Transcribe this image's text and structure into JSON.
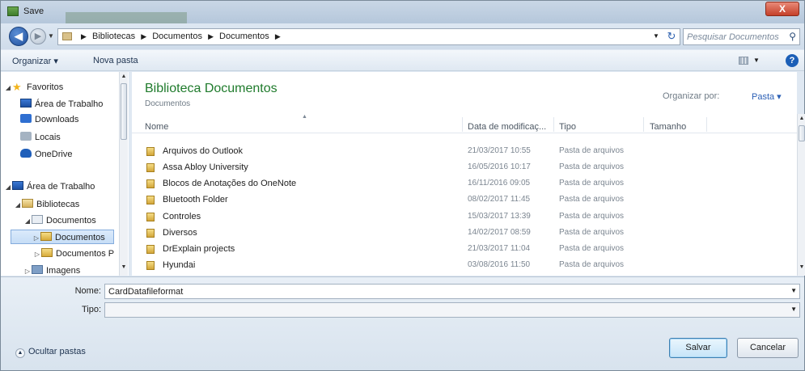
{
  "window": {
    "title": "Save",
    "close_label": "X"
  },
  "address": {
    "crumbs": [
      "Bibliotecas",
      "Documentos",
      "Documentos"
    ],
    "search_placeholder": "Pesquisar Documentos"
  },
  "toolbar": {
    "organize_label": "Organizar ▾",
    "new_folder_label": "Nova pasta",
    "help_label": "?"
  },
  "nav": {
    "items": [
      {
        "label": "Favoritos",
        "icon": "star-icon"
      },
      {
        "label": "Área de Trabalho",
        "icon": "desktop-icon"
      },
      {
        "label": "Downloads",
        "icon": "downloads-icon"
      },
      {
        "label": "Locais",
        "icon": "places-icon"
      },
      {
        "label": "OneDrive",
        "icon": "cloud-icon"
      },
      {
        "label": "Área de Trabalho",
        "icon": "desktop-icon"
      },
      {
        "label": "Bibliotecas",
        "icon": "library-icon"
      },
      {
        "label": "Documentos",
        "icon": "documents-icon"
      },
      {
        "label": "Documentos",
        "icon": "folder-icon"
      },
      {
        "label": "Documentos P",
        "icon": "folder-icon"
      },
      {
        "label": "Imagens",
        "icon": "images-icon"
      }
    ]
  },
  "content": {
    "library_title": "Biblioteca Documentos",
    "library_subtitle": "Documentos",
    "arrange_label": "Organizar por:",
    "arrange_value": "Pasta ▾",
    "columns": {
      "name": "Nome",
      "date": "Data de modificaç...",
      "type": "Tipo",
      "size": "Tamanho"
    },
    "files": [
      {
        "name": "Arquivos do Outlook",
        "date": "21/03/2017 10:55",
        "type": "Pasta de arquivos"
      },
      {
        "name": "Assa Abloy University",
        "date": "16/05/2016 10:17",
        "type": "Pasta de arquivos"
      },
      {
        "name": "Blocos de Anotações do OneNote",
        "date": "16/11/2016 09:05",
        "type": "Pasta de arquivos"
      },
      {
        "name": "Bluetooth Folder",
        "date": "08/02/2017 11:45",
        "type": "Pasta de arquivos"
      },
      {
        "name": "Controles",
        "date": "15/03/2017 13:39",
        "type": "Pasta de arquivos"
      },
      {
        "name": "Diversos",
        "date": "14/02/2017 08:59",
        "type": "Pasta de arquivos"
      },
      {
        "name": "DrExplain projects",
        "date": "21/03/2017 11:04",
        "type": "Pasta de arquivos"
      },
      {
        "name": "Hyundai",
        "date": "03/08/2016 11:50",
        "type": "Pasta de arquivos"
      }
    ]
  },
  "form": {
    "name_label": "Nome:",
    "name_value": "CardDatafileformat",
    "type_label": "Tipo:",
    "type_value": "",
    "hide_folders_label": "Ocultar pastas",
    "save_label": "Salvar",
    "cancel_label": "Cancelar"
  }
}
